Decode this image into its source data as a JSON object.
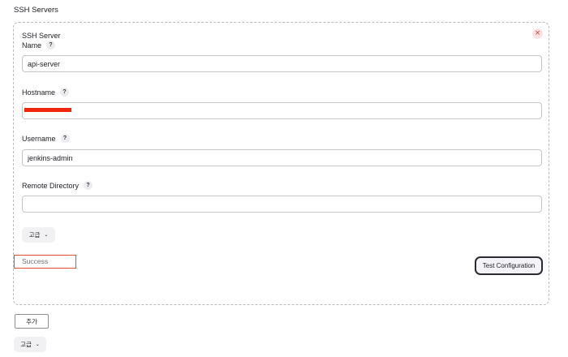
{
  "section": {
    "title": "SSH Servers"
  },
  "server": {
    "title": "SSH Server",
    "close_icon": "×",
    "name": {
      "label": "Name",
      "value": "api-server"
    },
    "hostname": {
      "label": "Hostname",
      "value": ""
    },
    "username": {
      "label": "Username",
      "value": "jenkins-admin"
    },
    "remote_directory": {
      "label": "Remote Directory",
      "value": ""
    },
    "advanced_label": "고급",
    "status_text": "Success",
    "test_button": "Test Configuration"
  },
  "help_glyph": "?",
  "chevron_glyph": "⌄",
  "add_button": "추가",
  "advanced_label": "고급",
  "colors": {
    "redaction": "#f1270d",
    "highlight_border": "#ea4a2e",
    "close_icon": "#e0342f"
  }
}
